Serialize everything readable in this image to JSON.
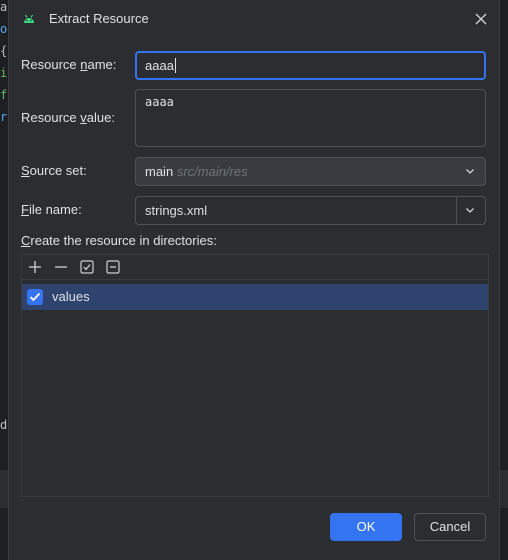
{
  "dialog": {
    "title": "Extract Resource",
    "icon": "android-icon",
    "close_icon": "close-icon"
  },
  "resource_name": {
    "label_pre": "Resource ",
    "label_mnemonic": "n",
    "label_post": "ame:",
    "value": "aaaa"
  },
  "resource_value": {
    "label_pre": "Resource ",
    "label_mnemonic": "v",
    "label_post": "alue:",
    "value": "aaaa"
  },
  "source_set": {
    "label_mnemonic": "S",
    "label_post": "ource set:",
    "value": "main",
    "hint": "src/main/res"
  },
  "file_name": {
    "label_mnemonic": "F",
    "label_post": "ile name:",
    "value": "strings.xml"
  },
  "directories": {
    "label_mnemonic": "C",
    "label_post": "reate the resource in directories:",
    "toolbar": [
      "add-icon",
      "remove-icon",
      "select-all-icon",
      "deselect-all-icon"
    ],
    "items": [
      {
        "label": "values",
        "checked": true,
        "selected": true
      }
    ]
  },
  "buttons": {
    "ok": "OK",
    "cancel": "Cancel"
  },
  "colors": {
    "accent": "#3574f0",
    "selection": "#2e436e",
    "background": "#2b2d30",
    "android_green": "#3ddc84"
  }
}
